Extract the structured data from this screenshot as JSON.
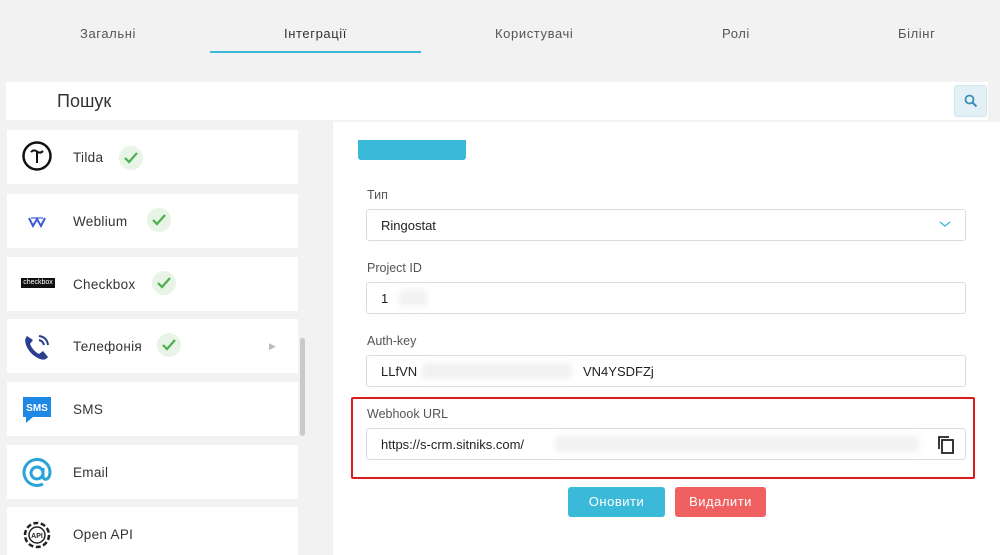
{
  "tabs": [
    {
      "label": "Загальні"
    },
    {
      "label": "Інтеграції",
      "active": true
    },
    {
      "label": "Користувачі"
    },
    {
      "label": "Ролі"
    },
    {
      "label": "Білінг"
    }
  ],
  "search": {
    "placeholder": "Пошук",
    "icon": "search-icon"
  },
  "sidebar": {
    "items": [
      {
        "label": "Tilda",
        "icon": "tilda-logo",
        "enabled": true
      },
      {
        "label": "Weblium",
        "icon": "weblium-logo",
        "enabled": true
      },
      {
        "label": "Checkbox",
        "icon": "checkbox-logo",
        "logo_text": "checkbox",
        "enabled": true
      },
      {
        "label": "Телефонія",
        "icon": "phone-icon",
        "enabled": true,
        "has_submenu": true
      },
      {
        "label": "SMS",
        "icon": "sms-icon",
        "icon_text": "SMS",
        "enabled": false
      },
      {
        "label": "Email",
        "icon": "at-sign-icon",
        "enabled": false
      },
      {
        "label": "Open API",
        "icon": "api-gear-icon",
        "icon_text": "API",
        "enabled": false
      }
    ]
  },
  "form": {
    "type_label": "Тип",
    "type_value": "Ringostat",
    "project_id_label": "Project ID",
    "project_id_value": "1",
    "auth_key_label": "Auth-key",
    "auth_key_value_start": "LLfVN",
    "auth_key_value_end": "VN4YSDFZj",
    "webhook_label": "Webhook URL",
    "webhook_value": "https://s-crm.sitniks.com/"
  },
  "buttons": {
    "update": "Оновити",
    "delete": "Видалити"
  },
  "colors": {
    "accent": "#3bb9d8",
    "danger": "#f06060",
    "highlight": "#e01b1b",
    "check_green": "#4caf50"
  }
}
